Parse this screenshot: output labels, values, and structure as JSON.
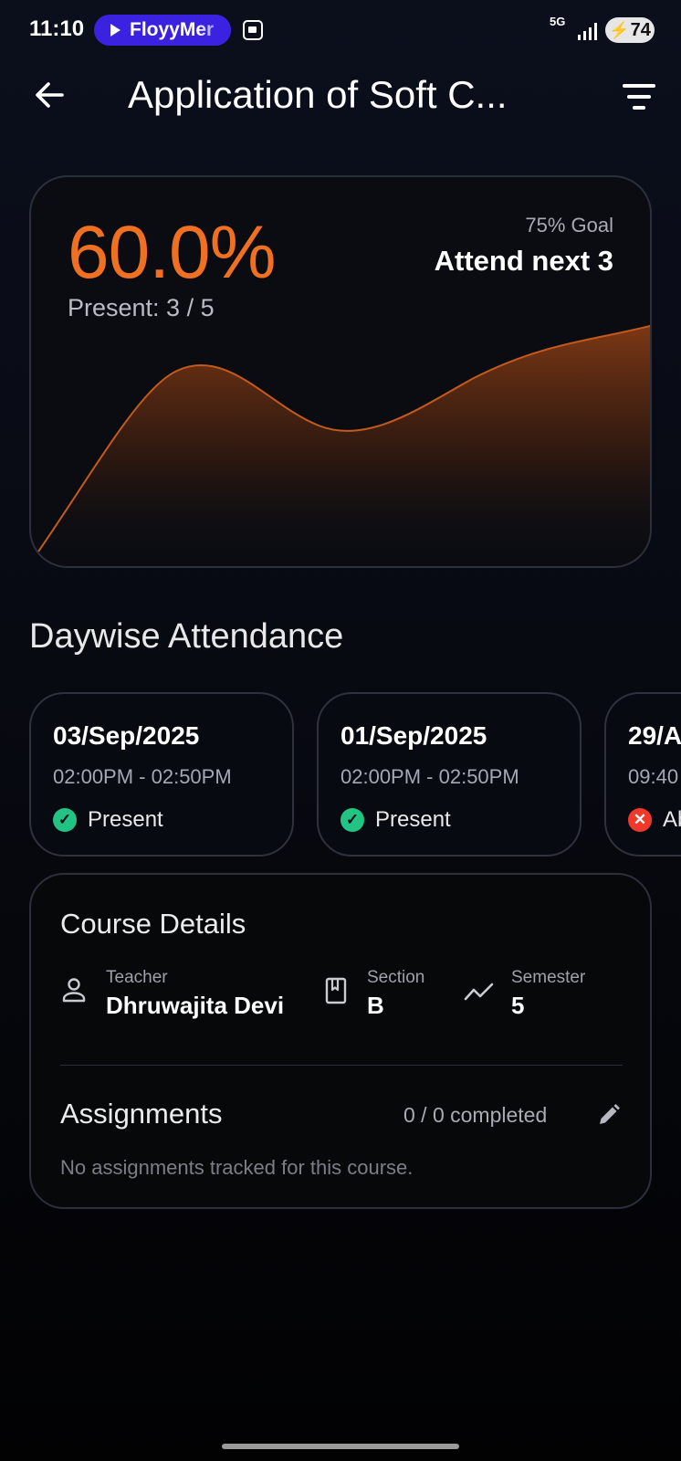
{
  "status_bar": {
    "time": "11:10",
    "media_pill": "FloyyMer",
    "network": "5G",
    "battery": "74"
  },
  "header": {
    "title": "Application of Soft C...",
    "back_icon": "arrow-left-icon",
    "filter_icon": "filter-list-icon"
  },
  "summary": {
    "percentage": "60.0%",
    "present": "Present: 3 / 5",
    "goal": "75% Goal",
    "goal_message": "Attend next 3",
    "accent_color": "#f07022"
  },
  "daywise": {
    "title": "Daywise Attendance",
    "items": [
      {
        "date": "03/Sep/2025",
        "time": "02:00PM - 02:50PM",
        "status": "Present",
        "status_icon": "check-circle-icon"
      },
      {
        "date": "01/Sep/2025",
        "time": "02:00PM - 02:50PM",
        "status": "Present",
        "status_icon": "check-circle-icon"
      },
      {
        "date": "29/A",
        "time": "09:40",
        "status": "Ab",
        "status_icon": "cancel-circle-icon"
      }
    ]
  },
  "course": {
    "title": "Course Details",
    "teacher_label": "Teacher",
    "teacher": "Dhruwajita Devi",
    "section_label": "Section",
    "section": "B",
    "semester_label": "Semester",
    "semester": "5",
    "assignments_title": "Assignments",
    "assignments_count": "0 / 0 completed",
    "assignments_empty": "No assignments tracked for this course."
  },
  "colors": {
    "present": "#22c483",
    "absent": "#ef3a2b"
  }
}
